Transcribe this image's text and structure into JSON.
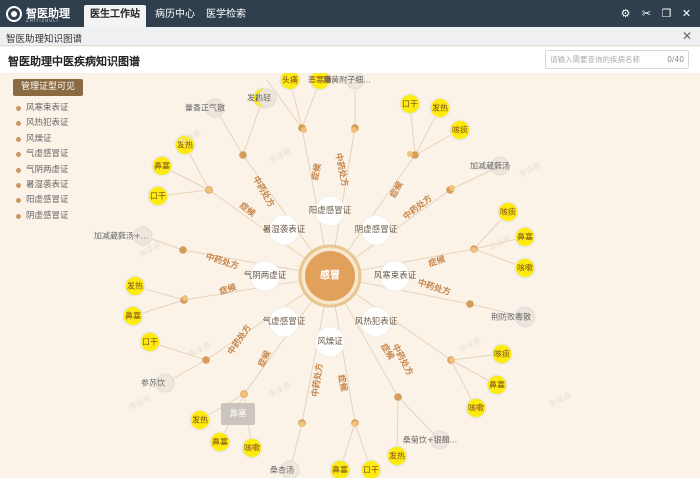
{
  "app": {
    "logo_text": "智医助理",
    "logo_sub": "ZHIYIZHULI"
  },
  "nav": [
    {
      "label": "医生工作站",
      "active": true
    },
    {
      "label": "病历中心",
      "active": false
    },
    {
      "label": "医学检索",
      "active": false
    }
  ],
  "toolbar": {
    "icons": [
      "gear-icon",
      "scissors-icon",
      "restore-icon",
      "close-icon"
    ]
  },
  "subwindow": {
    "title": "智医助理知识图谱"
  },
  "page": {
    "title": "智医助理中医疾病知识图谱"
  },
  "search": {
    "placeholder": "请输入需要查询的疾病名称",
    "count": "0/40"
  },
  "legend": {
    "title": "管理证型可见",
    "items": [
      "风寒束表证",
      "风热犯表证",
      "风燥证",
      "气虚感冒证",
      "气阴两虚证",
      "暑湿袭表证",
      "阳虚感冒证",
      "阴虚感冒证"
    ]
  },
  "graph": {
    "center": "感冒",
    "syndromes": [
      "风寒束表证",
      "风热犯表证",
      "风燥证",
      "气虚感冒证",
      "气阴两虚证",
      "暑湿袭表证",
      "阳虚感冒证",
      "阴虚感冒证"
    ],
    "edge_labels": {
      "symptom": "症候",
      "prescription": "中药处方"
    },
    "symptoms": [
      "头痛",
      "恶寒重",
      "发热",
      "口干",
      "咳痰",
      "鼻塞",
      "咳嗽",
      "发热",
      "鼻塞",
      "口干",
      "鼻塞",
      "发热",
      "鼻塞",
      "咳嗽",
      "咳痰",
      "鼻塞",
      "咳嗽",
      "发热",
      "鼻塞",
      "口干",
      "咳痰",
      "鼻塞",
      "发热",
      "发热",
      "咳嗽"
    ],
    "prescriptions": [
      "麻黄附子细...",
      "加减葳蕤汤",
      "荆防败毒散",
      "桑菊饮+银翘...",
      "桑杏汤",
      "参苏饮",
      "加减葳蕤汤+...",
      "藿香正气散",
      "发热轻"
    ],
    "tooltip": "鼻塞",
    "watermark": "李泽易"
  }
}
